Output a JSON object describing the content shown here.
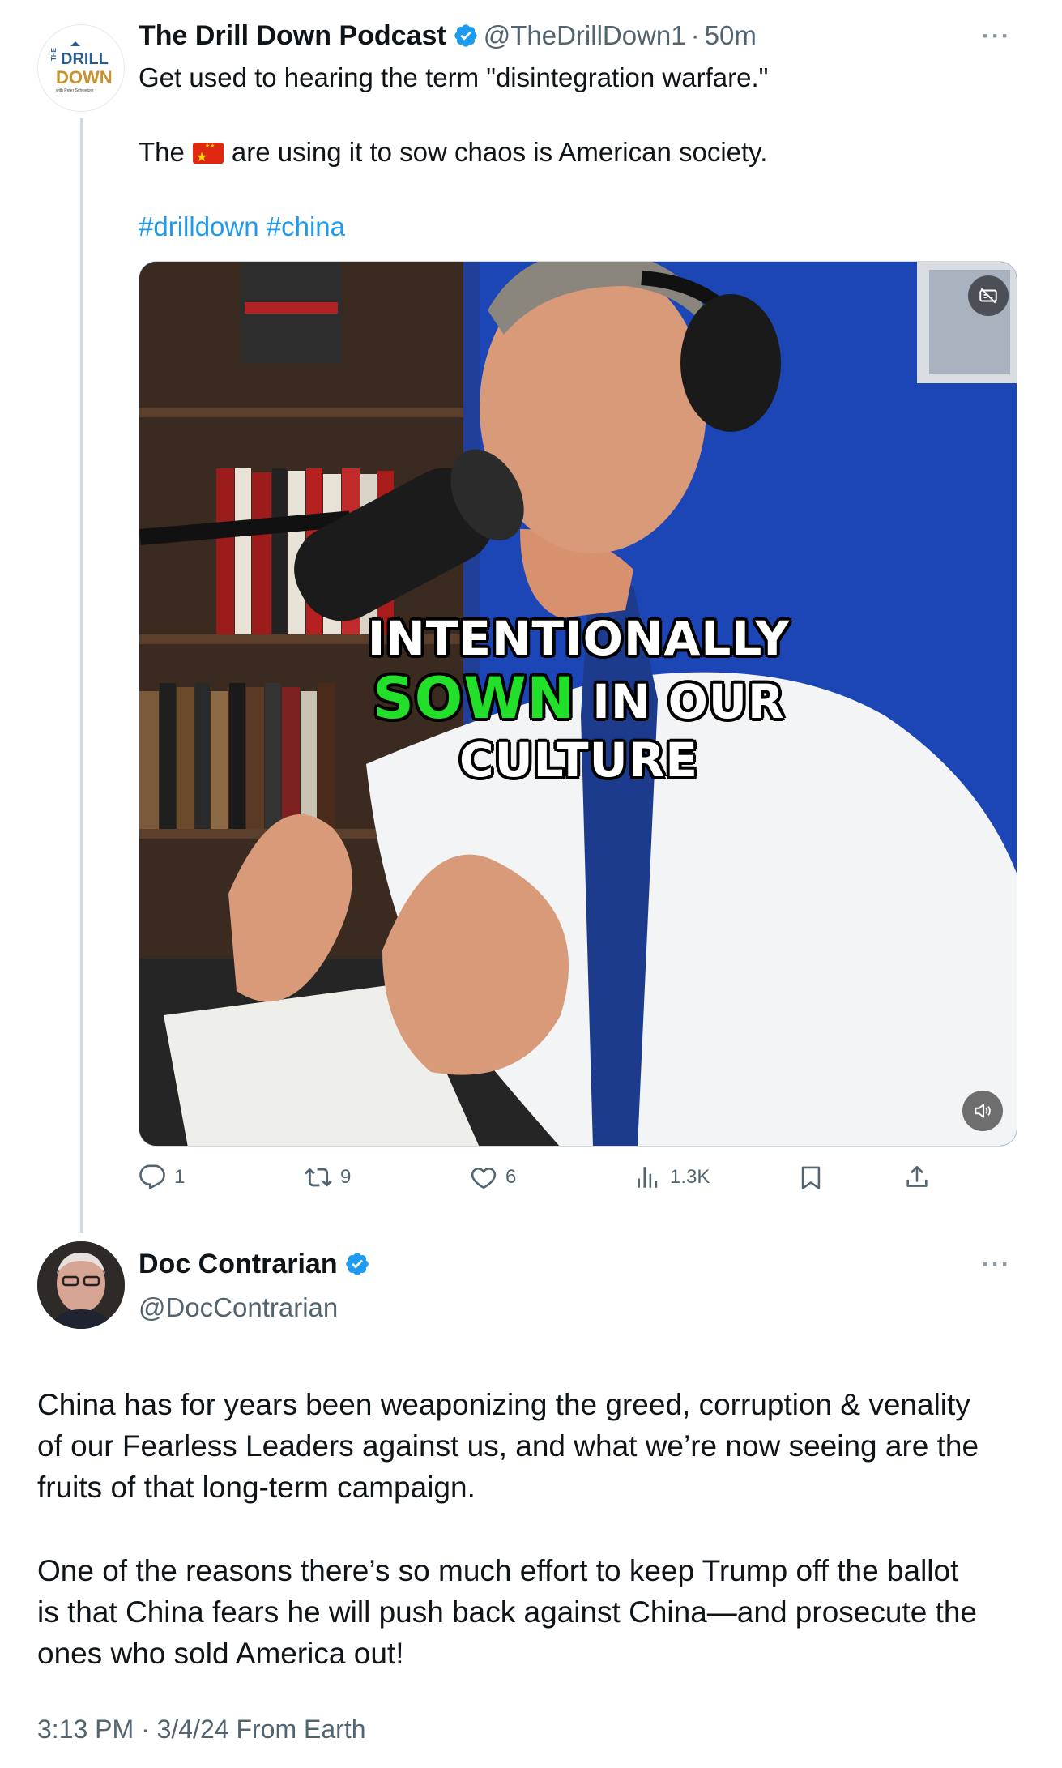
{
  "tweet1": {
    "avatar_text_top": "THE",
    "avatar_text_mid": "DRILL",
    "avatar_text_bottom": "DOWN",
    "avatar_subtext": "with Peter Schweizer",
    "author_name": "The Drill Down Podcast",
    "handle": "@TheDrillDown1",
    "separator": "·",
    "time": "50m",
    "more_label": "···",
    "line1": "Get used to hearing the term \"disintegration warfare.\"",
    "line2_before": "The",
    "line2_after": "are using it to sow chaos is American society.",
    "flag_icon": "china-flag",
    "hashtag1": "#drilldown",
    "hashtag2": "#china",
    "media": {
      "caption_line1": "INTENTIONALLY",
      "caption_green": "SOWN",
      "caption_line2_rest": "IN OUR",
      "caption_line3": "CULTURE",
      "accent_green": "#22e02a"
    },
    "actions": {
      "replies": "1",
      "reposts": "9",
      "likes": "6",
      "views": "1.3K"
    }
  },
  "tweet2": {
    "author_name": "Doc Contrarian",
    "handle": "@DocContrarian",
    "more_label": "···",
    "paragraph1_line1": "China has for years been weaponizing the greed, corruption & venality",
    "paragraph1_line2": "of our Fearless Leaders against us, and what we’re now seeing are the",
    "paragraph1_line3": "fruits of that long-term campaign.",
    "paragraph2_line1": "One of the reasons there’s so much effort to keep Trump off the ballot",
    "paragraph2_line2": "is that China fears he will push back against China—and prosecute the",
    "paragraph2_line3": "ones who sold America out!",
    "meta": "3:13 PM · 3/4/24 From Earth"
  },
  "colors": {
    "link": "#1d9bf0",
    "verified": "#1d9bf0",
    "secondary_text": "#536471",
    "thread_line": "#cfd9de"
  }
}
